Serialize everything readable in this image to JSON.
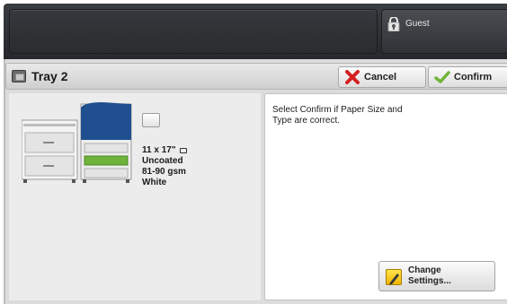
{
  "header": {
    "guest_label": "Guest",
    "guest_icon": "padlock-user-icon"
  },
  "tray": {
    "title": "Tray 2",
    "icon": "tray-icon",
    "cancel_label": "Cancel",
    "cancel_icon": "red-x-icon",
    "confirm_label": "Confirm",
    "confirm_icon": "green-check-icon"
  },
  "paper": {
    "size": "11 x 17\"",
    "orientation_icon": "landscape-orientation-icon",
    "type": "Uncoated",
    "weight": "81-90 gsm",
    "color": "White"
  },
  "message": {
    "instruction_line1": "Select Confirm if Paper Size and",
    "instruction_line2": "Type are correct.",
    "change_line1": "Change",
    "change_line2": "Settings...",
    "change_icon": "pencil-icon"
  },
  "colors": {
    "header_dark": "#2c2e31",
    "accent_green": "#6fb33a",
    "accent_red": "#d62020",
    "pencil_yellow": "#f5c800",
    "printer_blue": "#1f4f8f"
  }
}
